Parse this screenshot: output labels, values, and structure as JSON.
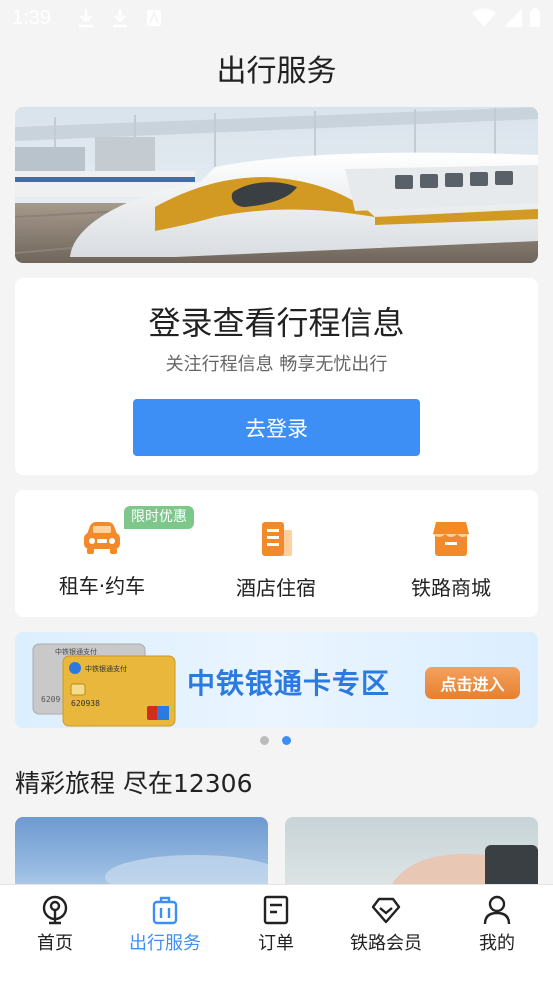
{
  "status_bar": {
    "time": "1:39"
  },
  "page": {
    "title": "出行服务"
  },
  "login": {
    "title": "登录查看行程信息",
    "subtitle": "关注行程信息  畅享无忧出行",
    "button_label": "去登录"
  },
  "services": [
    {
      "label": "租车·约车",
      "icon": "car-icon",
      "badge": "限时优惠"
    },
    {
      "label": "酒店住宿",
      "icon": "hotel-icon"
    },
    {
      "label": "铁路商城",
      "icon": "shop-icon"
    }
  ],
  "promo_banner": {
    "title": "中铁银通卡专区",
    "button_label": "点击进入",
    "card_text_1": "中铁银通支付",
    "card_text_2": "中铁银通支付",
    "card_number": "6209",
    "card_number_2": "620938"
  },
  "carousel": {
    "total": 2,
    "active": 2
  },
  "section": {
    "title": "精彩旅程 尽在12306"
  },
  "tabbar": [
    {
      "label": "首页",
      "icon": "railway-logo-icon",
      "active": false
    },
    {
      "label": "出行服务",
      "icon": "luggage-icon",
      "active": true
    },
    {
      "label": "订单",
      "icon": "order-icon",
      "active": false
    },
    {
      "label": "铁路会员",
      "icon": "diamond-icon",
      "active": false
    },
    {
      "label": "我的",
      "icon": "user-icon",
      "active": false
    }
  ],
  "colors": {
    "accent": "#3d8ff6",
    "promo_orange": "#e5802f",
    "badge_green": "#7dc78a"
  }
}
